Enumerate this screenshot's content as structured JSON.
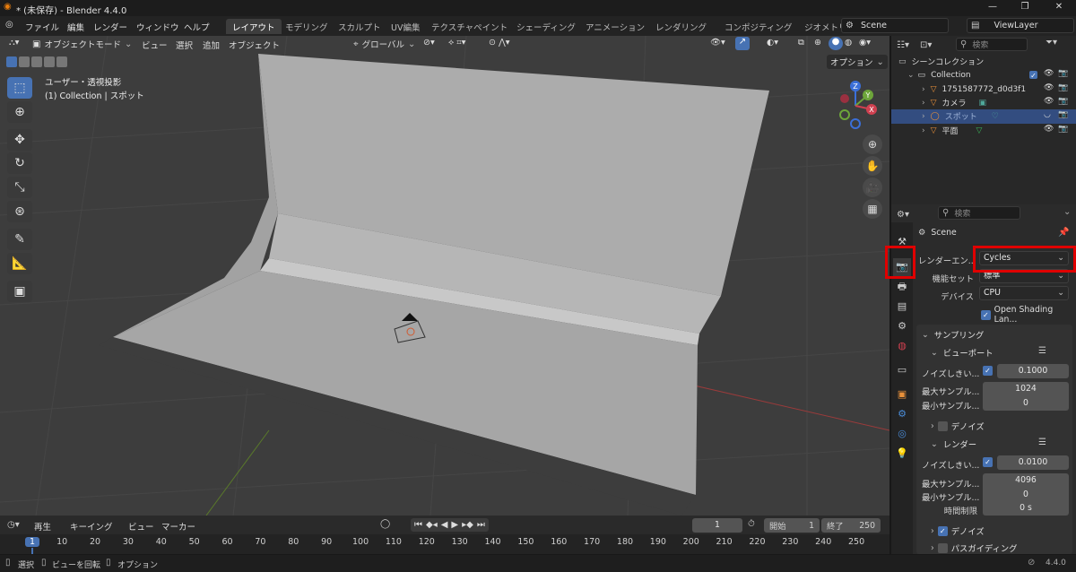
{
  "window": {
    "title": "* (未保存) - Blender 4.4.0",
    "minimize": "—",
    "maximize": "❐",
    "close": "✕"
  },
  "menubar": [
    "ファイル",
    "編集",
    "レンダー",
    "ウィンドウ",
    "ヘルプ"
  ],
  "workspaces": [
    {
      "label": "レイアウト",
      "active": true
    },
    {
      "label": "モデリング"
    },
    {
      "label": "スカルプト"
    },
    {
      "label": "UV編集"
    },
    {
      "label": "テクスチャペイント"
    },
    {
      "label": "シェーディング"
    },
    {
      "label": "アニメーション"
    },
    {
      "label": "レンダリング"
    },
    {
      "label": "コンポジティング"
    },
    {
      "label": "ジオメトリ"
    }
  ],
  "scene_field": "Scene",
  "viewlayer_field": "ViewLayer",
  "viewport": {
    "mode": "オブジェクトモード",
    "menus": [
      "ビュー",
      "選択",
      "追加",
      "オブジェクト"
    ],
    "transform_orientation": "グローバル",
    "options_label": "オプション",
    "view_name": "ユーザー・透視投影",
    "active_info": "(1) Collection | スポット",
    "gizmo_axes": {
      "x": "X",
      "y": "Y",
      "z": "Z"
    }
  },
  "outliner": {
    "search_placeholder": "検索",
    "scene_collection": "シーンコレクション",
    "items": [
      {
        "label": "Collection",
        "selected": false
      },
      {
        "label": "1751587772_d0d3f1",
        "selected": false
      },
      {
        "label": "カメラ",
        "selected": false
      },
      {
        "label": "スポット",
        "selected": true
      },
      {
        "label": "平面",
        "selected": false
      }
    ]
  },
  "properties": {
    "search_placeholder": "検索",
    "context_name": "Scene",
    "render_engine_label": "レンダーエン...",
    "render_engine_value": "Cycles",
    "feature_set_label": "機能セット",
    "feature_set_value": "標準",
    "device_label": "デバイス",
    "device_value": "CPU",
    "osl_label": "Open Shading Lan...",
    "sampling_header": "サンプリング",
    "viewport_header": "ビューポート",
    "viewport_noise_label": "ノイズしきい...",
    "viewport_noise_value": "0.1000",
    "viewport_max_label": "最大サンプル...",
    "viewport_max_value": "1024",
    "viewport_min_label": "最小サンプル...",
    "viewport_min_value": "0",
    "denoise_label": "デノイズ",
    "render_header": "レンダー",
    "render_noise_label": "ノイズしきい...",
    "render_noise_value": "0.0100",
    "render_max_label": "最大サンプル...",
    "render_max_value": "4096",
    "render_min_label": "最小サンプル...",
    "render_min_value": "0",
    "time_limit_label": "時間制限",
    "time_limit_value": "0 s",
    "render_denoise_label": "デノイズ",
    "path_guiding_label": "パスガイディング"
  },
  "timeline": {
    "menus": [
      "再生",
      "キーイング",
      "ビュー",
      "マーカー"
    ],
    "current_frame": "1",
    "start_label": "開始",
    "start_value": "1",
    "end_label": "終了",
    "end_value": "250",
    "ticks": [
      "1",
      "10",
      "20",
      "30",
      "40",
      "50",
      "60",
      "70",
      "80",
      "90",
      "100",
      "110",
      "120",
      "130",
      "140",
      "150",
      "160",
      "170",
      "180",
      "190",
      "200",
      "210",
      "220",
      "230",
      "240",
      "250"
    ]
  },
  "statusbar": {
    "select": "選択",
    "rotate": "ビューを回転",
    "options": "オプション",
    "version": "4.4.0"
  },
  "colors": {
    "accent": "#4772b3",
    "highlight_box": "#e00000",
    "selected_row": "#334d80"
  }
}
